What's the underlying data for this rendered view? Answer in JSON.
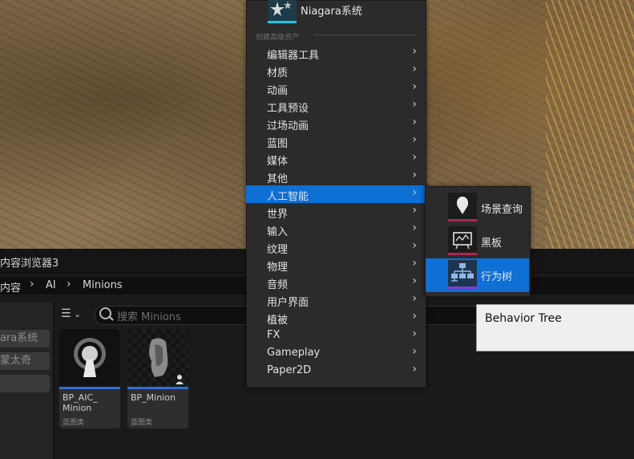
{
  "content_browser": {
    "title": "内容浏览器3",
    "breadcrumb": [
      "内容",
      "AI",
      "Minions"
    ],
    "sidebar_items": [
      "ara系统",
      "蒙太奇",
      ""
    ],
    "search_placeholder": "搜索 Minions",
    "assets": [
      {
        "name": "BP_AIC_ Minion",
        "type": "蓝图类",
        "icon": "ai-controller-icon"
      },
      {
        "name": "BP_Minion",
        "type": "蓝图类",
        "icon": "character-bust-icon"
      }
    ]
  },
  "context_menu": {
    "top_item": "Niagara系统",
    "section_header": "创建高级资产",
    "items": [
      "编辑器工具",
      "材质",
      "动画",
      "工具预设",
      "过场动画",
      "蓝图",
      "媒体",
      "其他",
      "人工智能",
      "世界",
      "输入",
      "纹理",
      "物理",
      "音频",
      "用户界面",
      "植被",
      "FX",
      "Gameplay",
      "Paper2D"
    ],
    "active_item": "人工智能"
  },
  "submenu": {
    "items": [
      {
        "label": "场景查询",
        "icon": "env-query-icon",
        "color": "#b0264b"
      },
      {
        "label": "黑板",
        "icon": "blackboard-icon",
        "color": "#b0264b"
      },
      {
        "label": "行为树",
        "icon": "behavior-tree-icon",
        "color": "#7a3fd0"
      }
    ],
    "active_item": "行为树"
  },
  "tooltip": {
    "text": "Behavior Tree"
  },
  "colors": {
    "accent": "#0e6fd4",
    "asset_line": "#2e6fd6",
    "niagara": "#21c5e8"
  }
}
